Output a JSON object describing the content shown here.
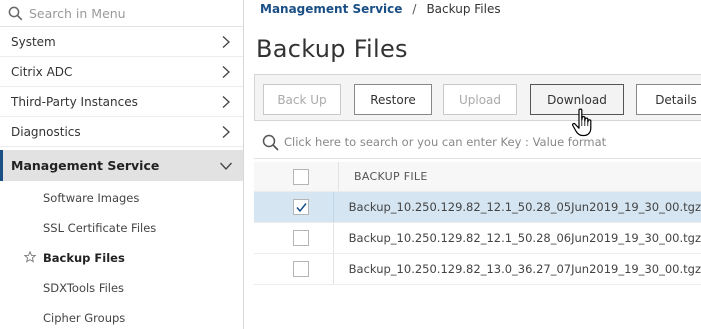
{
  "sidebar": {
    "search_placeholder": "Search in Menu",
    "items": [
      {
        "label": "System"
      },
      {
        "label": "Citrix ADC"
      },
      {
        "label": "Third-Party Instances"
      },
      {
        "label": "Diagnostics"
      }
    ],
    "active_section": {
      "label": "Management Service"
    },
    "sub_items": [
      {
        "label": "Software Images"
      },
      {
        "label": "SSL Certificate Files"
      },
      {
        "label": "Backup Files"
      },
      {
        "label": "SDXTools Files"
      },
      {
        "label": "Cipher Groups"
      }
    ]
  },
  "breadcrumb": {
    "parent": "Management Service",
    "separator": "/",
    "current": "Backup Files"
  },
  "page_title": "Backup Files",
  "toolbar": {
    "back_up": "Back Up",
    "restore": "Restore",
    "upload": "Upload",
    "download": "Download",
    "details": "Details"
  },
  "table": {
    "search_placeholder": "Click here to search or you can enter Key : Value format",
    "column_header": "BACKUP FILE",
    "rows": [
      {
        "file": "Backup_10.250.129.82_12.1_50.28_05Jun2019_19_30_00.tgz",
        "selected": true
      },
      {
        "file": "Backup_10.250.129.82_12.1_50.28_06Jun2019_19_30_00.tgz",
        "selected": false
      },
      {
        "file": "Backup_10.250.129.82_13.0_36.27_07Jun2019_19_30_00.tgz",
        "selected": false
      }
    ]
  },
  "icons": {
    "search": "search-icon",
    "chevron_right": "chevron-right-icon",
    "chevron_down": "chevron-down-icon",
    "star": "star-icon",
    "check": "check-icon",
    "cursor": "hand-cursor-icon"
  },
  "colors": {
    "accent": "#1a4f86",
    "selected_row": "#d5e5f1",
    "active_nav_bg": "#e2e2e2"
  }
}
